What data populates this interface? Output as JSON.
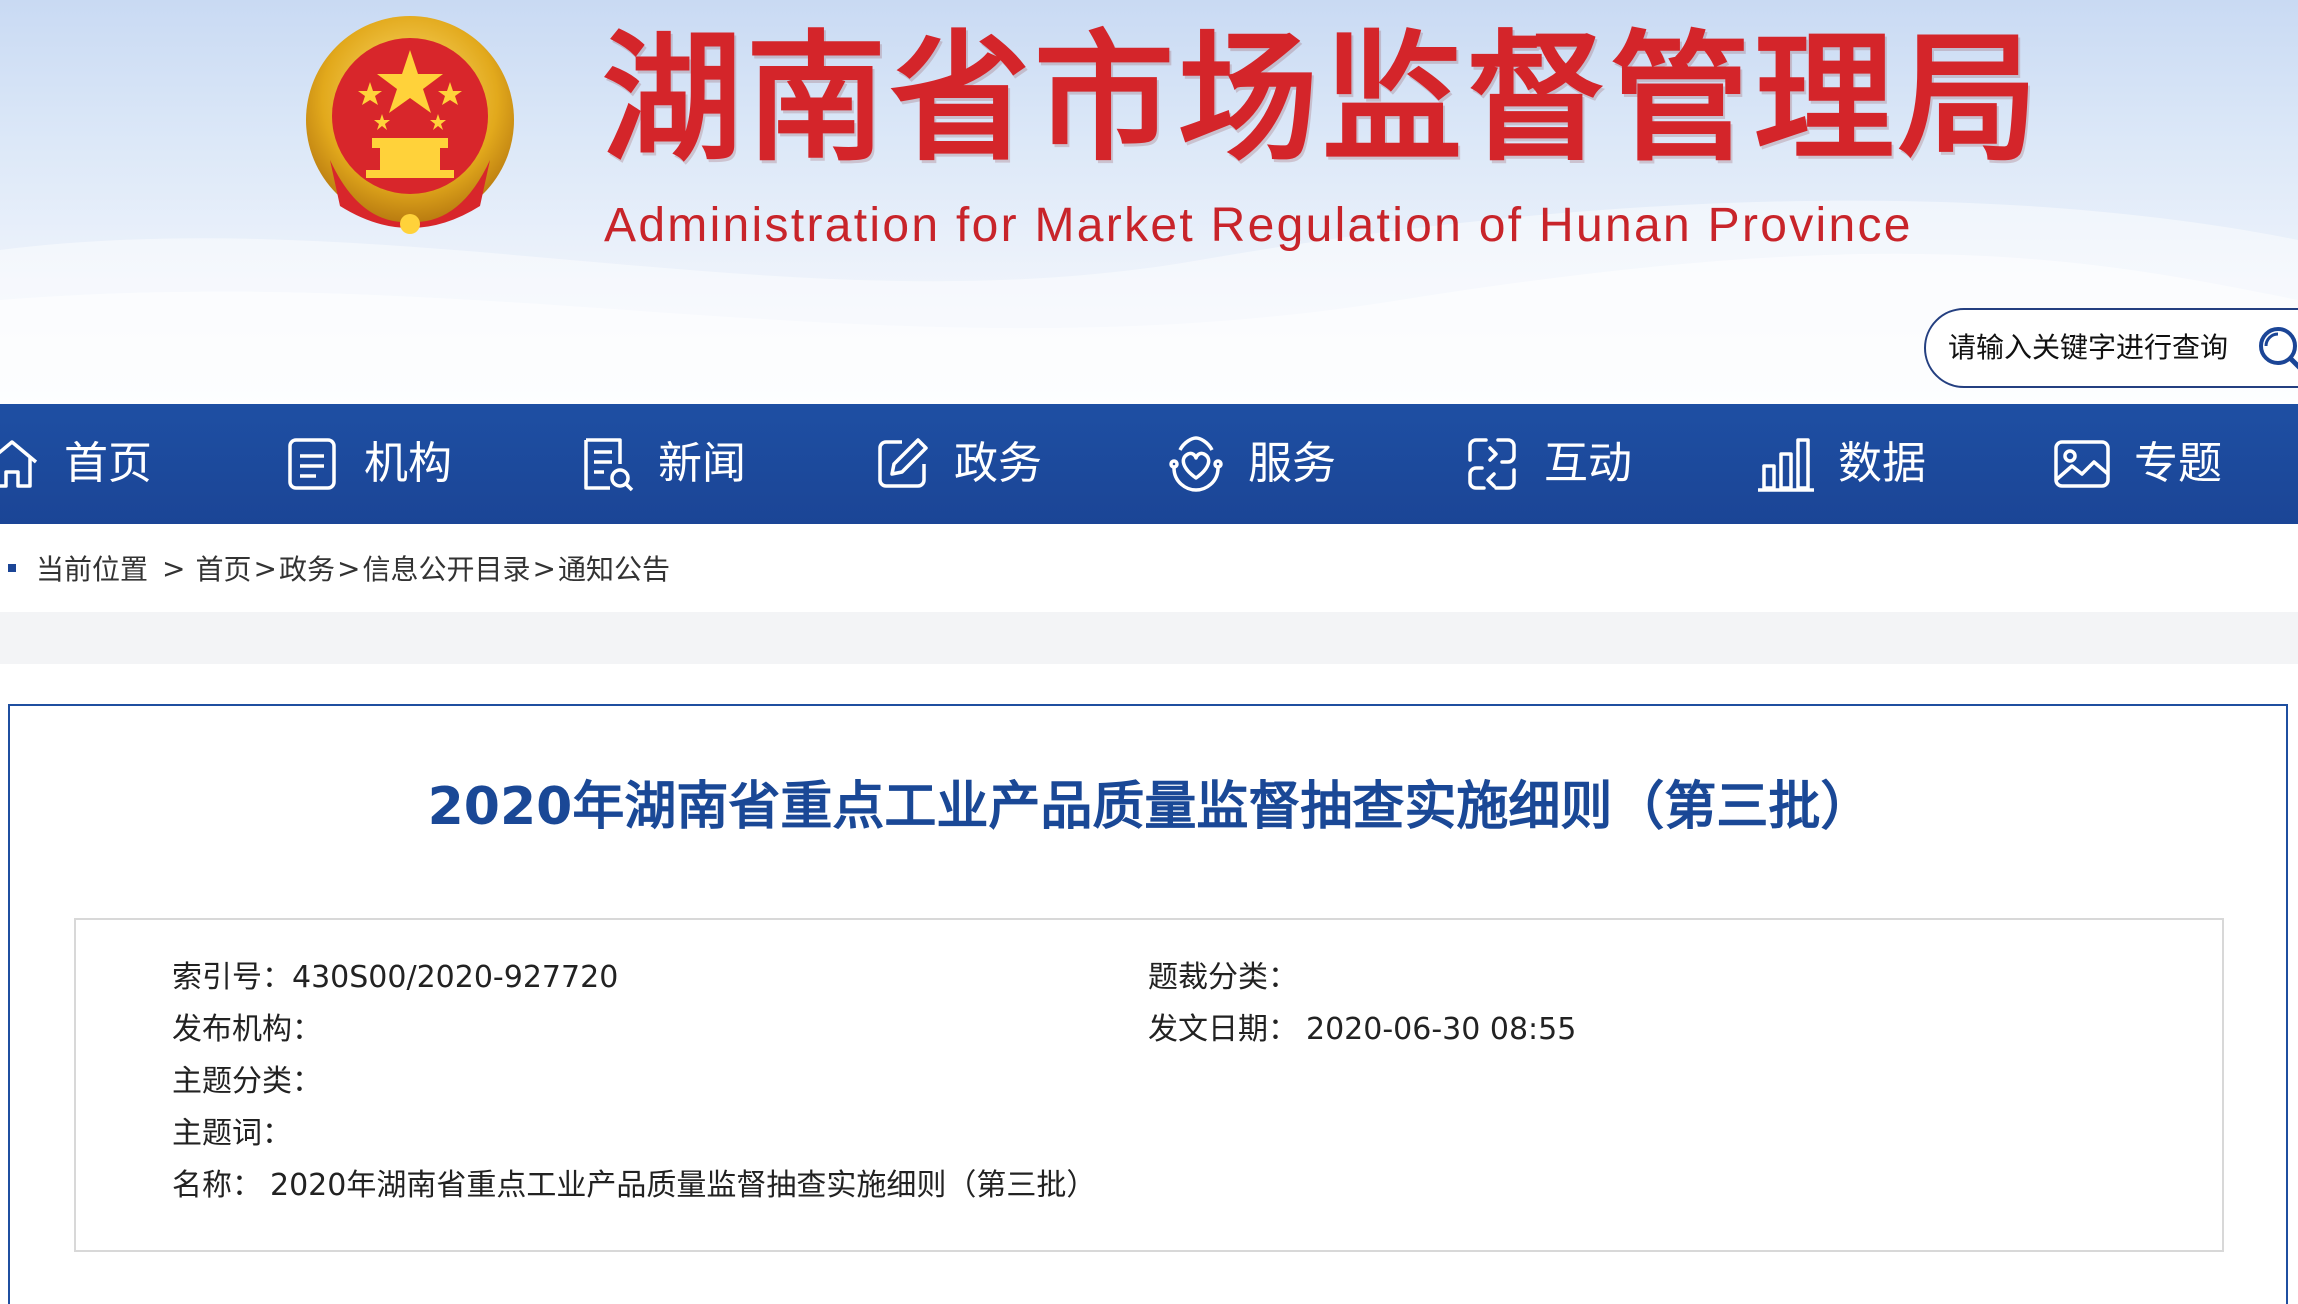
{
  "header": {
    "title_cn": "湖南省市场监督管理局",
    "title_en": "Administration for Market Regulation of Hunan Province",
    "search_placeholder": "请输入关键字进行查询"
  },
  "colors": {
    "brand_red": "#d4252a",
    "nav_blue": "#1b4596",
    "title_blue": "#1a4896"
  },
  "nav": {
    "items": [
      {
        "label": "首页",
        "icon": "home-icon"
      },
      {
        "label": "机构",
        "icon": "document-icon"
      },
      {
        "label": "新闻",
        "icon": "news-icon"
      },
      {
        "label": "政务",
        "icon": "edit-icon"
      },
      {
        "label": "服务",
        "icon": "heart-hands-icon"
      },
      {
        "label": "互动",
        "icon": "interaction-icon"
      },
      {
        "label": "数据",
        "icon": "bar-chart-icon"
      },
      {
        "label": "专题",
        "icon": "image-icon"
      }
    ]
  },
  "breadcrumb": {
    "here": "当前位置",
    "first_sep": ">",
    "items": [
      "首页",
      "政务",
      "信息公开目录",
      "通知公告"
    ],
    "sep": ">"
  },
  "article": {
    "title": "2020年湖南省重点工业产品质量监督抽查实施细则（第三批）",
    "meta": {
      "index_label": "索引号：",
      "index_value": "430S00/2020-927720",
      "genre_label": "题裁分类：",
      "genre_value": "",
      "publisher_label": "发布机构：",
      "publisher_value": "",
      "date_label": "发文日期：",
      "date_value": "2020-06-30 08:55",
      "topic_label": "主题分类：",
      "topic_value": "",
      "keywords_label": "主题词：",
      "keywords_value": "",
      "name_label": "名称：",
      "name_value": "2020年湖南省重点工业产品质量监督抽查实施细则（第三批）"
    }
  }
}
